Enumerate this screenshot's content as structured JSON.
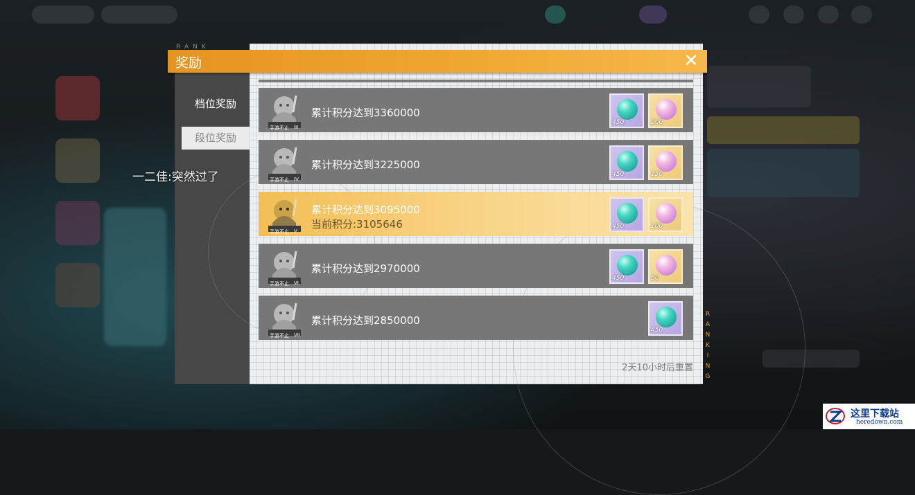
{
  "dialog": {
    "title": "奖励",
    "close_icon": "close-icon",
    "rank_label_top": "RANK",
    "ranking_vertical": "RANKING",
    "reset_text": "2天10小时后重置"
  },
  "tabs": [
    {
      "label": "档位奖励",
      "active": true
    },
    {
      "label": "段位奖励",
      "active": false
    }
  ],
  "chat_message": "一二佳:突然过了",
  "rewards": [
    {
      "tier_icon": "tier-badge-III",
      "requirement": "累计积分达到3360000",
      "current": null,
      "items": [
        {
          "icon": "gem-orb-icon",
          "qty": "450"
        },
        {
          "icon": "star-orb-icon",
          "qty": "200"
        }
      ]
    },
    {
      "tier_icon": "tier-badge-IV",
      "requirement": "累计积分达到3225000",
      "current": null,
      "items": [
        {
          "icon": "gem-orb-icon",
          "qty": "450"
        },
        {
          "icon": "star-orb-icon",
          "qty": "150"
        }
      ]
    },
    {
      "tier_icon": "tier-badge-V",
      "requirement": "累计积分达到3095000",
      "current": "当前积分:3105646",
      "highlighted": true,
      "items": [
        {
          "icon": "gem-orb-icon",
          "qty": "450"
        },
        {
          "icon": "star-orb-icon",
          "qty": "100"
        }
      ]
    },
    {
      "tier_icon": "tier-badge-VI",
      "requirement": "累计积分达到2970000",
      "current": null,
      "items": [
        {
          "icon": "gem-orb-icon",
          "qty": "450"
        },
        {
          "icon": "star-orb-icon",
          "qty": "50"
        }
      ]
    },
    {
      "tier_icon": "tier-badge-VII",
      "requirement": "累计积分达到2850000",
      "current": null,
      "items": [
        {
          "icon": "gem-orb-icon",
          "qty": "450"
        }
      ]
    }
  ],
  "tier_badges": [
    "III",
    "IV",
    "V",
    "VI",
    "VII"
  ],
  "badge_caption": "手游不止",
  "watermark": {
    "cn": "这里下载站",
    "en": "heredown.com"
  },
  "colors": {
    "accent": "#f0a731",
    "highlight": "#f9d487",
    "row": "#777777"
  }
}
